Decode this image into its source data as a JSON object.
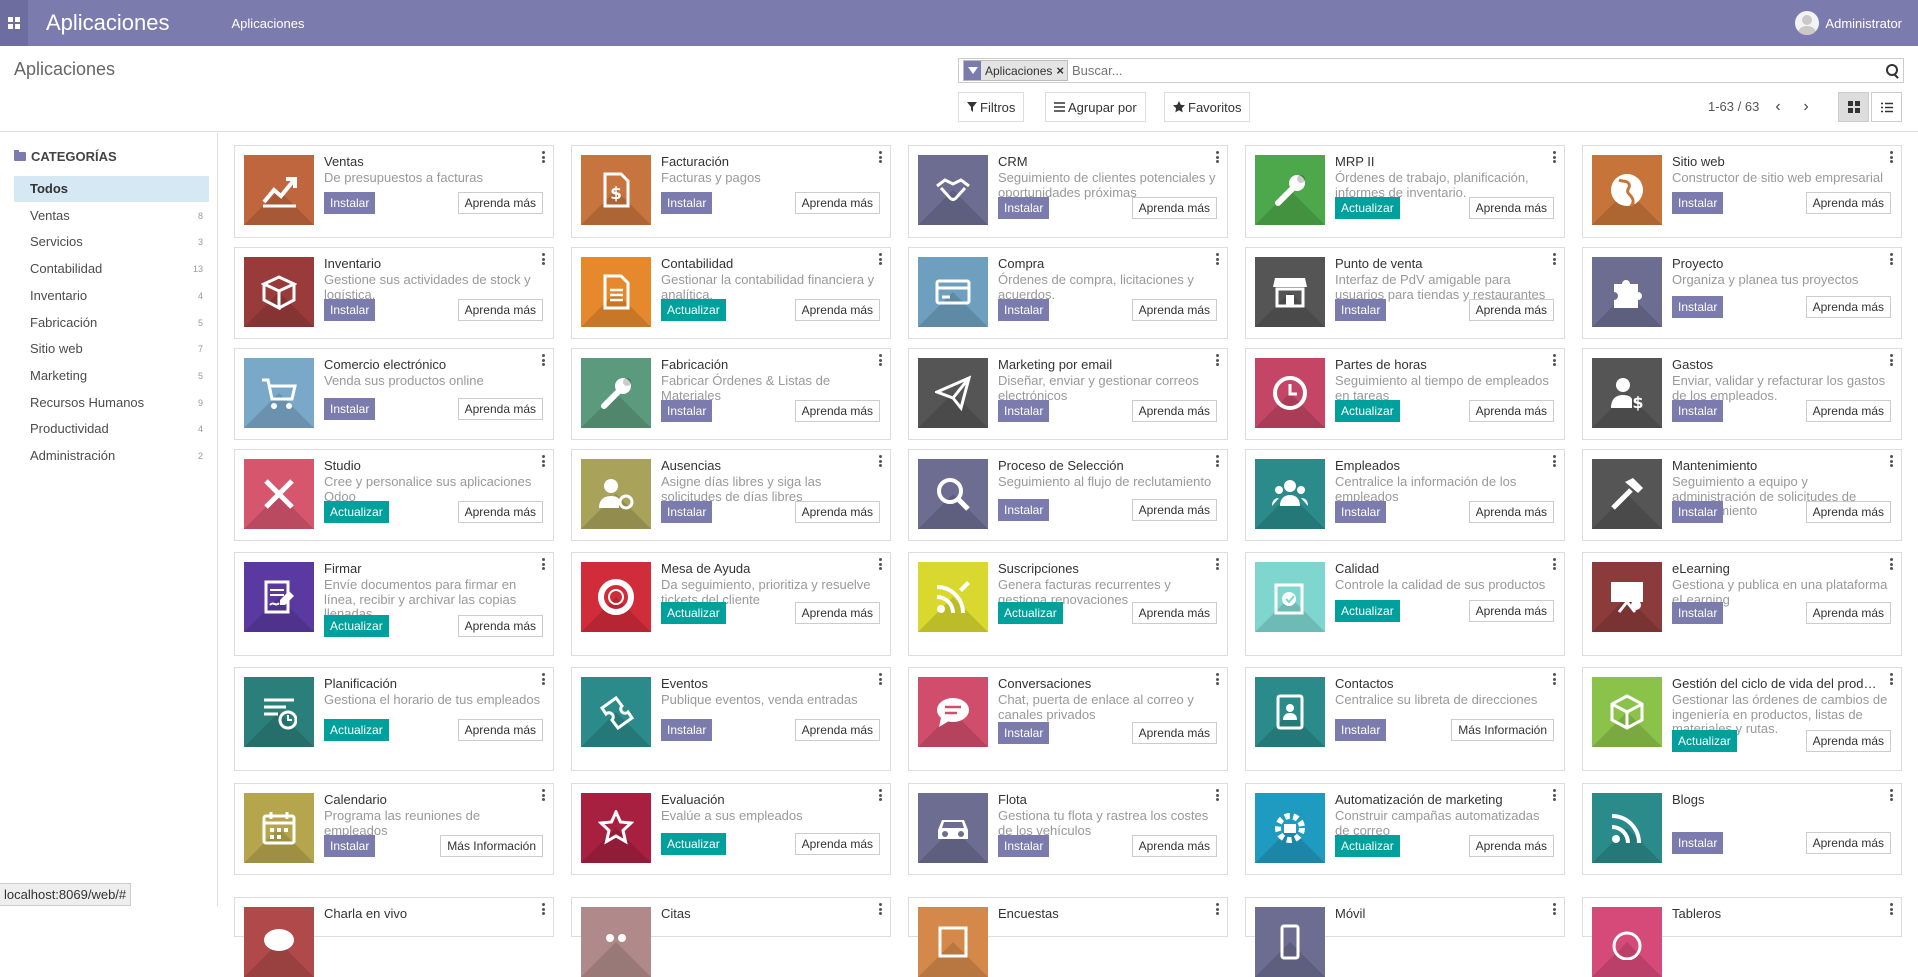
{
  "nav": {
    "brand": "Aplicaciones",
    "menu": "Aplicaciones",
    "user": "Administrator"
  },
  "cp": {
    "breadcrumb": "Aplicaciones",
    "facet": "Aplicaciones",
    "search_placeholder": "Buscar...",
    "filters": "Filtros",
    "group_by": "Agrupar por",
    "favorites": "Favoritos",
    "pager": "1-63 / 63"
  },
  "sidebar": {
    "title": "CATEGORÍAS",
    "items": [
      {
        "label": "Todos",
        "count": ""
      },
      {
        "label": "Ventas",
        "count": "8"
      },
      {
        "label": "Servicios",
        "count": "3"
      },
      {
        "label": "Contabilidad",
        "count": "13"
      },
      {
        "label": "Inventario",
        "count": "4"
      },
      {
        "label": "Fabricación",
        "count": "5"
      },
      {
        "label": "Sitio web",
        "count": "7"
      },
      {
        "label": "Marketing",
        "count": "5"
      },
      {
        "label": "Recursos Humanos",
        "count": "9"
      },
      {
        "label": "Productividad",
        "count": "4"
      },
      {
        "label": "Administración",
        "count": "2"
      }
    ]
  },
  "apps": [
    {
      "name": "Ventas",
      "desc": "De presupuestos a facturas",
      "action": "Instalar",
      "more": "Aprenda más",
      "color": "#c0663e",
      "icon": "chart-icon"
    },
    {
      "name": "Facturación",
      "desc": "Facturas y pagos",
      "action": "Instalar",
      "more": "Aprenda más",
      "color": "#c8743f",
      "icon": "invoice-icon"
    },
    {
      "name": "CRM",
      "desc": "Seguimiento de clientes potenciales y oportunidades próximas",
      "action": "Instalar",
      "more": "Aprenda más",
      "color": "#6d6c91",
      "icon": "handshake-icon"
    },
    {
      "name": "MRP II",
      "desc": "Órdenes de trabajo, planificación, informes de inventario.",
      "action": "Actualizar",
      "more": "Aprenda más",
      "color": "#4ca84a",
      "icon": "wrench-icon"
    },
    {
      "name": "Sitio web",
      "desc": "Constructor de sitio web empresarial",
      "action": "Instalar",
      "more": "Aprenda más",
      "color": "#c7743a",
      "icon": "globe-icon"
    },
    {
      "name": "Inventario",
      "desc": "Gestione sus actividades de stock y logística.",
      "action": "Instalar",
      "more": "Aprenda más",
      "color": "#9a3b3b",
      "icon": "box-icon"
    },
    {
      "name": "Contabilidad",
      "desc": "Gestionar la contabilidad financiera y analítica.",
      "action": "Actualizar",
      "more": "Aprenda más",
      "color": "#e5892c",
      "icon": "document-icon"
    },
    {
      "name": "Compra",
      "desc": "Órdenes de compra, licitaciones y acuerdos.",
      "action": "Instalar",
      "more": "Aprenda más",
      "color": "#6e9fbf",
      "icon": "credit-card-icon"
    },
    {
      "name": "Punto de venta",
      "desc": "Interfaz de PdV amigable para usuarios para tiendas y restaurantes",
      "action": "Instalar",
      "more": "Aprenda más",
      "color": "#555555",
      "icon": "store-icon"
    },
    {
      "name": "Proyecto",
      "desc": "Organiza y planea tus proyectos",
      "action": "Instalar",
      "more": "Aprenda más",
      "color": "#6d6c91",
      "icon": "puzzle-icon"
    },
    {
      "name": "Comercio electrónico",
      "desc": "Venda sus productos online",
      "action": "Instalar",
      "more": "Aprenda más",
      "color": "#7aa8c8",
      "icon": "cart-icon"
    },
    {
      "name": "Fabricación",
      "desc": "Fabricar Órdenes & Listas de Materiales",
      "action": "Instalar",
      "more": "Aprenda más",
      "color": "#5b9a7c",
      "icon": "wrench-icon"
    },
    {
      "name": "Marketing por email",
      "desc": "Diseñar, enviar y gestionar correos electrónicos",
      "action": "Instalar",
      "more": "Aprenda más",
      "color": "#555555",
      "icon": "paper-plane-icon"
    },
    {
      "name": "Partes de horas",
      "desc": "Seguimiento al tiempo de empleados en tareas",
      "action": "Actualizar",
      "more": "Aprenda más",
      "color": "#c44566",
      "icon": "clock-icon"
    },
    {
      "name": "Gastos",
      "desc": "Enviar, validar y refacturar los gastos de los empleados.",
      "action": "Instalar",
      "more": "Aprenda más",
      "color": "#555555",
      "icon": "user-dollar-icon"
    },
    {
      "name": "Studio",
      "desc": "Cree y personalice sus aplicaciones Odoo",
      "action": "Actualizar",
      "more": "Aprenda más",
      "color": "#d6566e",
      "icon": "tools-icon"
    },
    {
      "name": "Ausencias",
      "desc": "Asigne días libres y siga las solicitudes de días libres",
      "action": "Instalar",
      "more": "Aprenda más",
      "color": "#a8a25a",
      "icon": "user-gear-icon"
    },
    {
      "name": "Proceso de Selección",
      "desc": "Seguimiento al flujo de reclutamiento",
      "action": "Instalar",
      "more": "Aprenda más",
      "color": "#6d6c91",
      "icon": "magnifier-icon"
    },
    {
      "name": "Empleados",
      "desc": "Centralice la información de los empleados",
      "action": "Instalar",
      "more": "Aprenda más",
      "color": "#2b8a8a",
      "icon": "users-icon"
    },
    {
      "name": "Mantenimiento",
      "desc": "Seguimiento a equipo y administración de solicitudes de mantenimiento",
      "action": "Instalar",
      "more": "Aprenda más",
      "color": "#555555",
      "icon": "hammer-icon"
    },
    {
      "name": "Firmar",
      "desc": "Envíe documentos para firmar en línea, recibir y archivar las copias llenadas",
      "action": "Actualizar",
      "more": "Aprenda más",
      "color": "#5a3aa0",
      "icon": "sign-icon"
    },
    {
      "name": "Mesa de Ayuda",
      "desc": "Da seguimiento, prioritiza y resuelve tickets del cliente",
      "action": "Actualizar",
      "more": "Aprenda más",
      "color": "#d12c3a",
      "icon": "lifebuoy-icon"
    },
    {
      "name": "Suscripciones",
      "desc": "Genera facturas recurrentes y gestiona renovaciones",
      "action": "Actualizar",
      "more": "Aprenda más",
      "color": "#d8d82e",
      "icon": "rss-pen-icon"
    },
    {
      "name": "Calidad",
      "desc": "Controle la calidad de sus productos",
      "action": "Actualizar",
      "more": "Aprenda más",
      "color": "#7fd6cf",
      "icon": "quality-icon"
    },
    {
      "name": "eLearning",
      "desc": "Gestiona y publica en una plataforma eLearning",
      "action": "Instalar",
      "more": "Aprenda más",
      "color": "#8c3b3b",
      "icon": "presentation-icon"
    },
    {
      "name": "Planificación",
      "desc": "Gestiona el horario de tus empleados",
      "action": "Actualizar",
      "more": "Aprenda más",
      "color": "#2b7f7a",
      "icon": "planning-icon"
    },
    {
      "name": "Eventos",
      "desc": "Publique eventos, venda entradas",
      "action": "Instalar",
      "more": "Aprenda más",
      "color": "#2b8a8a",
      "icon": "ticket-icon"
    },
    {
      "name": "Conversaciones",
      "desc": "Chat, puerta de enlace al correo y canales privados",
      "action": "Instalar",
      "more": "Aprenda más",
      "color": "#d04d6b",
      "icon": "chat-icon"
    },
    {
      "name": "Contactos",
      "desc": "Centralice su libreta de direcciones",
      "action": "Instalar",
      "more": "Más Información",
      "color": "#2b8a8a",
      "icon": "address-book-icon"
    },
    {
      "name": "Gestión del ciclo de vida del producto (PLM)",
      "desc": "Gestionar las órdenes de cambios de ingeniería en productos, listas de materiales y rutas.",
      "action": "Actualizar",
      "more": "Aprenda más",
      "color": "#8bc34a",
      "icon": "cube-icon"
    },
    {
      "name": "Calendario",
      "desc": "Programa las reuniones de empleados",
      "action": "Instalar",
      "more": "Más Información",
      "color": "#b5a64e",
      "icon": "calendar-icon"
    },
    {
      "name": "Evaluación",
      "desc": "Evalúe a sus empleados",
      "action": "Actualizar",
      "more": "Aprenda más",
      "color": "#a82040",
      "icon": "star-icon"
    },
    {
      "name": "Flota",
      "desc": "Gestiona tu flota y rastrea los costes de los vehículos",
      "action": "Instalar",
      "more": "Aprenda más",
      "color": "#6d6c91",
      "icon": "car-icon"
    },
    {
      "name": "Automatización de marketing",
      "desc": "Construir campañas automatizadas de correo",
      "action": "Actualizar",
      "more": "Aprenda más",
      "color": "#1f9ac1",
      "icon": "gear-mail-icon"
    },
    {
      "name": "Blogs",
      "desc": "",
      "action": "Instalar",
      "more": "Aprenda más",
      "color": "#2b8a8a",
      "icon": "rss-icon"
    },
    {
      "name": "Charla en vivo",
      "desc": "",
      "action": "",
      "more": "",
      "color": "#b04a4a",
      "icon": "livechat-icon"
    },
    {
      "name": "Citas",
      "desc": "",
      "action": "",
      "more": "",
      "color": "#b08a8a",
      "icon": "appointment-icon"
    },
    {
      "name": "Encuestas",
      "desc": "",
      "action": "",
      "more": "",
      "color": "#d4884a",
      "icon": "survey-icon"
    },
    {
      "name": "Móvil",
      "desc": "",
      "action": "",
      "more": "",
      "color": "#6d6c91",
      "icon": "mobile-icon"
    },
    {
      "name": "Tableros",
      "desc": "",
      "action": "",
      "more": "",
      "color": "#d64a7a",
      "icon": "dashboard-icon"
    }
  ],
  "status_url": "localhost:8069/web/#"
}
